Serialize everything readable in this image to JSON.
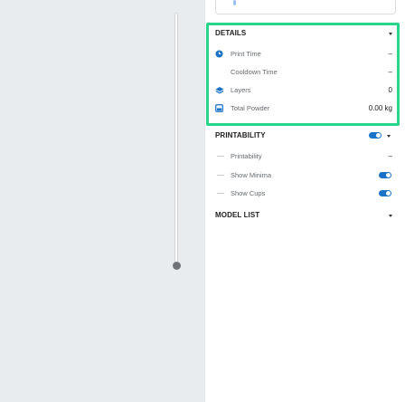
{
  "details": {
    "title": "DETAILS",
    "rows": [
      {
        "label": "Print Time",
        "value": "–",
        "icon": "clock-icon"
      },
      {
        "label": "Cooldown Time",
        "value": "–",
        "icon": ""
      },
      {
        "label": "Layers",
        "value": "0",
        "icon": "layers-icon"
      },
      {
        "label": "Total Powder",
        "value": "0.00 kg",
        "icon": "powder-container-icon"
      }
    ]
  },
  "printability": {
    "title": "PRINTABILITY",
    "toggle_on": true,
    "rows": [
      {
        "label": "Printability",
        "value": "–"
      },
      {
        "label": "Show Minima",
        "toggle_on": true
      },
      {
        "label": "Show Cups",
        "toggle_on": true
      }
    ]
  },
  "model_list": {
    "title": "MODEL LIST"
  },
  "colors": {
    "accent": "#1a73c9",
    "highlight": "#27d68a"
  }
}
